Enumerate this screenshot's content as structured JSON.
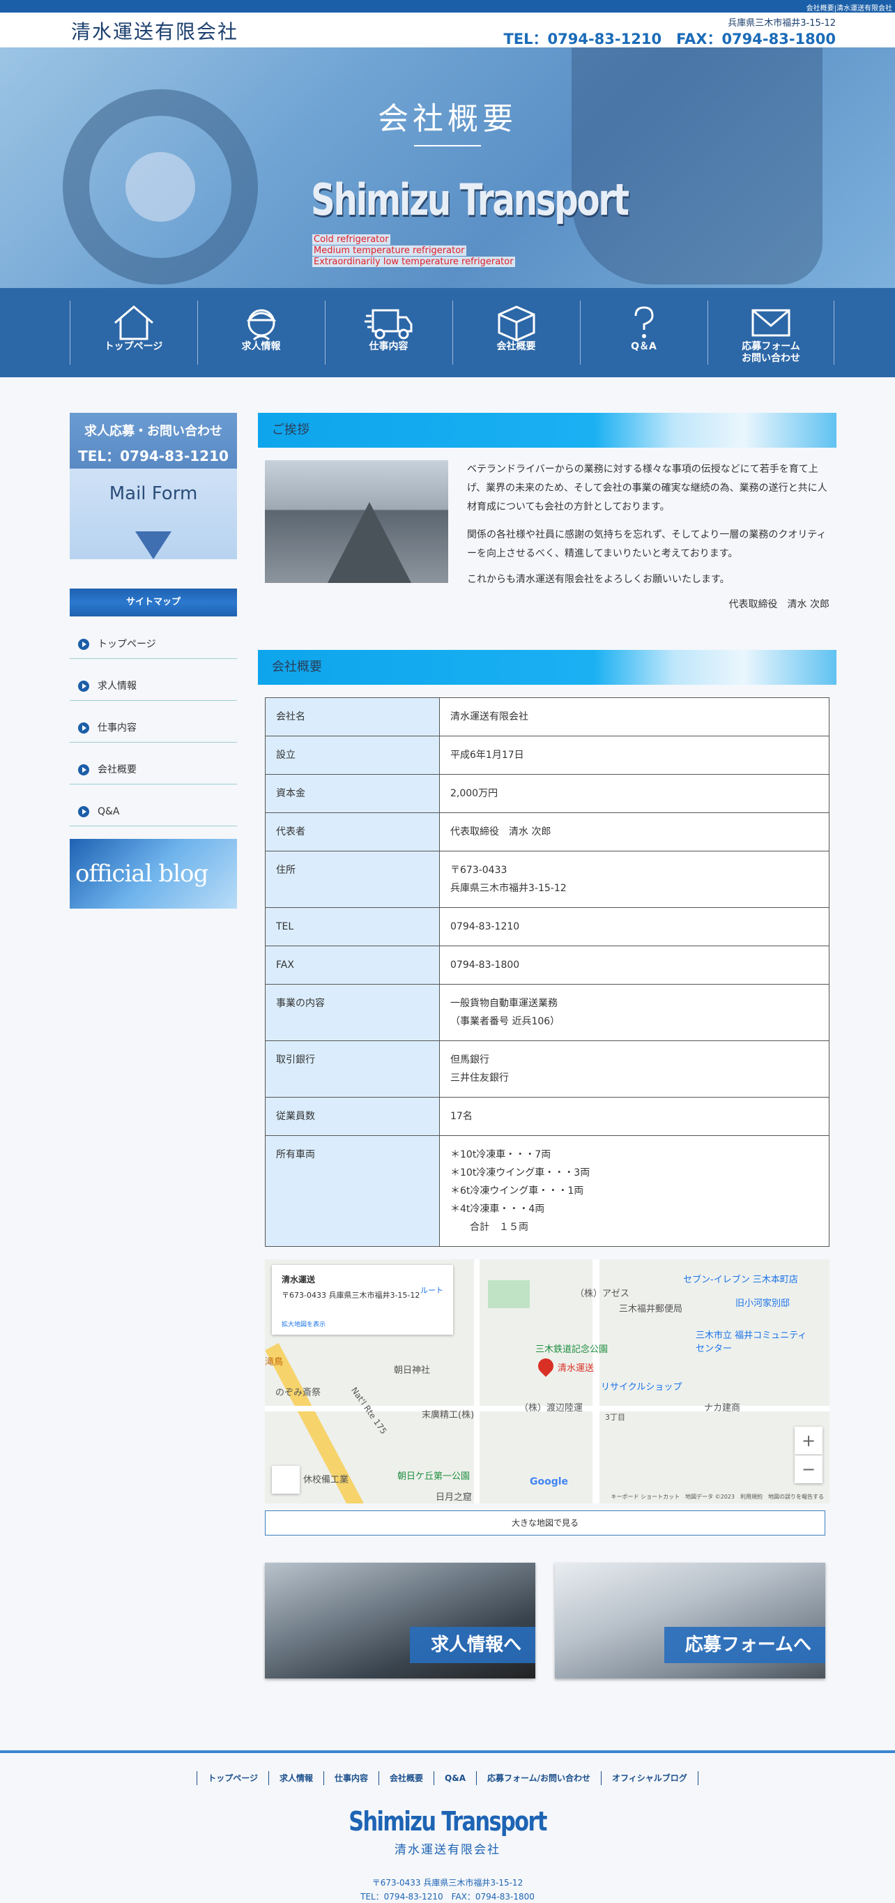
{
  "top_strip": "会社概要|清水運送有限会社",
  "header": {
    "logo": "清水運送有限会社",
    "address": "兵庫県三木市福井3-15-12",
    "tel_fax": "TEL：0794-83-1210　FAX：0794-83-1800"
  },
  "hero": {
    "title": "会社概要",
    "brand": "Shimizu Transport",
    "taglines": [
      "Cold refrigerator",
      "Medium temperature refrigerator",
      "Extraordinarily low temperature refrigerator"
    ]
  },
  "nav": [
    {
      "label": "トップページ",
      "icon": "house-icon"
    },
    {
      "label": "求人情報",
      "icon": "worker-icon"
    },
    {
      "label": "仕事内容",
      "icon": "truck-icon"
    },
    {
      "label": "会社概要",
      "icon": "box-icon"
    },
    {
      "label": "Q＆A",
      "icon": "question-icon"
    },
    {
      "label": "応募フォーム",
      "label2": "お問い合わせ",
      "icon": "mail-icon"
    }
  ],
  "sidebar": {
    "cta_title": "求人応募・お問い合わせ",
    "cta_tel": "TEL：0794-83-1210",
    "cta_mail": "Mail Form",
    "sitemap_title": "サイトマップ",
    "sitemap": [
      "トップページ",
      "求人情報",
      "仕事内容",
      "会社概要",
      "Q&A"
    ],
    "blog": "official blog"
  },
  "greeting": {
    "title": "ご挨拶",
    "p1": "ベテランドライバーからの業務に対する様々な事項の伝授などにて若手を育て上げ、業界の未来のため、そして会社の事業の確実な継続の為、業務の遂行と共に人材育成についても会社の方針としております。",
    "p2": "関係の各社様や社員に感謝の気持ちを忘れず、そしてより一層の業務のクオリティーを向上させるべく、精進してまいりたいと考えております。",
    "p3": "これからも清水運送有限会社をよろしくお願いいたします。",
    "sign": "代表取締役　清水 次郎"
  },
  "overview": {
    "title": "会社概要",
    "rows": [
      {
        "k": "会社名",
        "v": "清水運送有限会社"
      },
      {
        "k": "設立",
        "v": "平成6年1月17日"
      },
      {
        "k": "資本金",
        "v": "2,000万円"
      },
      {
        "k": "代表者",
        "v": "代表取締役　清水 次郎"
      },
      {
        "k": "住所",
        "v": "〒673-0433",
        "v2": "兵庫県三木市福井3-15-12"
      },
      {
        "k": "TEL",
        "v": "0794-83-1210"
      },
      {
        "k": "FAX",
        "v": "0794-83-1800"
      },
      {
        "k": "事業の内容",
        "v": "一般貨物自動車運送業務",
        "v2": "（事業者番号 近兵106）"
      },
      {
        "k": "取引銀行",
        "v": "但馬銀行",
        "v2": "三井住友銀行"
      },
      {
        "k": "従業員数",
        "v": "17名"
      },
      {
        "k": "所有車両",
        "v": "＊10t冷凍車・・・7両",
        "v2": "＊10t冷凍ウイング車・・・3両",
        "v3": "＊6t冷凍ウイング車・・・1両",
        "v4": "＊4t冷凍車・・・4両",
        "v5": "　　合計　１５両"
      }
    ]
  },
  "map": {
    "card_title": "清水運送",
    "card_addr": "〒673-0433 兵庫県三木市福井3-15-12",
    "card_link": "拡大地図を表示",
    "route": "ルート",
    "pin_label": "清水運送",
    "labels": [
      "（株）アゼス",
      "三木福井郵便局",
      "セブン-イレブン 三木本町店",
      "旧小河家別邸",
      "三木市立 福井コミュニティセンター",
      "三木鉄道記念公園",
      "リサイクルショップ",
      "朝日神社",
      "のぞみ斎祭",
      "末廣精工(株)",
      "（株）渡辺陸運",
      "ナカ建商",
      "3丁目",
      "Nat'l Rte 175",
      "朝日ケ丘第一公園",
      "日月之窟",
      "休校備工業",
      "滝鳥"
    ],
    "footer": "キーボード ショートカット　地図データ ©2023　利用規約　地図の誤りを報告する",
    "google": "Google",
    "zoom_in": "+",
    "zoom_out": "−",
    "big_map": "大きな地図で見る"
  },
  "banners": {
    "recruit": "求人情報へ",
    "form": "応募フォームへ"
  },
  "footer": {
    "nav": [
      "トップページ",
      "求人情報",
      "仕事内容",
      "会社概要",
      "Q&A",
      "応募フォーム/お問い合わせ",
      "オフィシャルブログ"
    ],
    "brand": "Shimizu Transport",
    "name": "清水運送有限会社",
    "address": "〒673-0433 兵庫県三木市福井3-15-12",
    "tel_fax": "TEL：0794-83-1210　FAX：0794-83-1800"
  }
}
